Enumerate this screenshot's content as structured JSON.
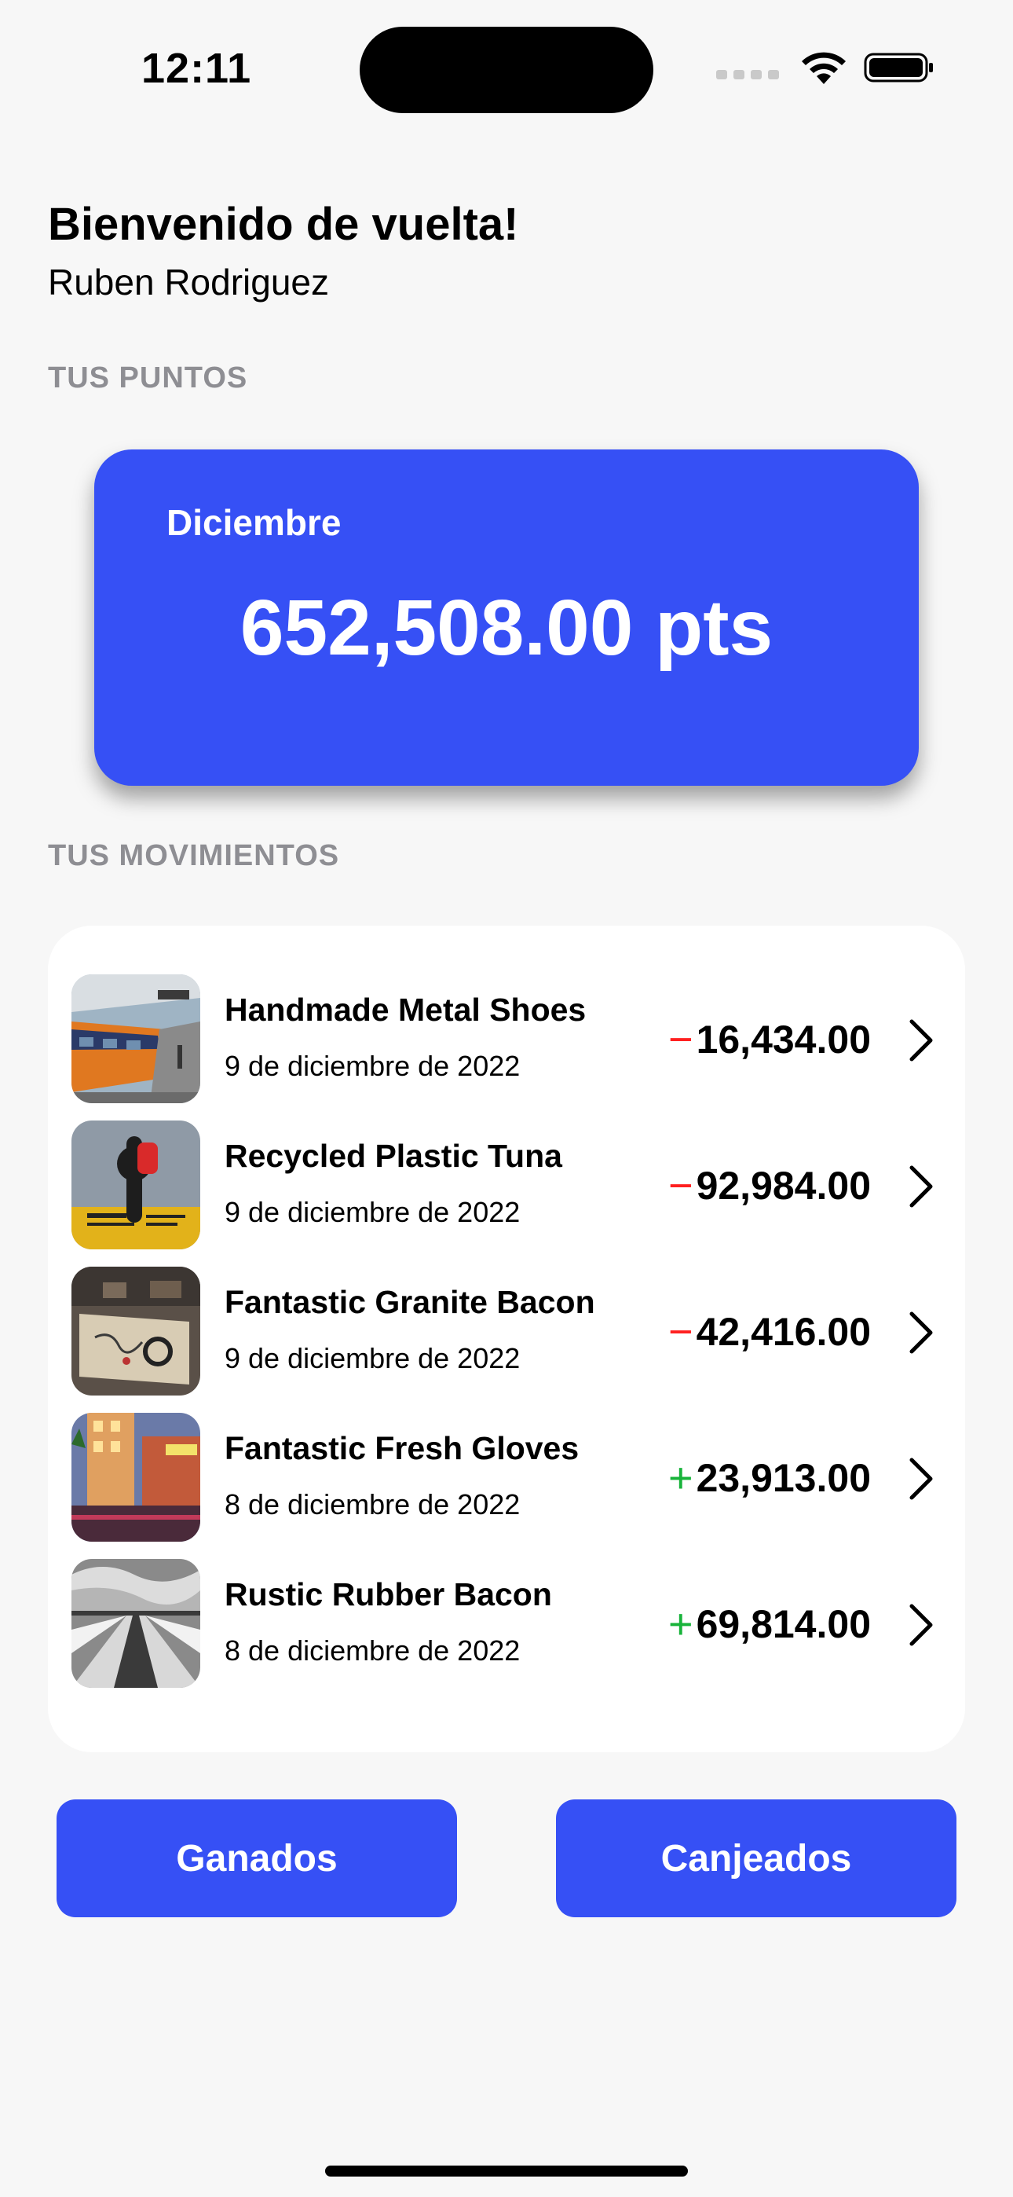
{
  "status_bar": {
    "time": "12:11"
  },
  "header": {
    "welcome": "Bienvenido de vuelta!",
    "user_name": "Ruben Rodriguez"
  },
  "points_section": {
    "label": "TUS PUNTOS",
    "month": "Diciembre",
    "value": "652,508.00 pts",
    "card_color": "#3650f5"
  },
  "movements_section": {
    "label": "TUS MOVIMIENTOS",
    "items": [
      {
        "title": "Handmade Metal Shoes",
        "date": "9 de diciembre de 2022",
        "sign": "−",
        "amount": "16,434.00",
        "type": "negative",
        "image": "train-station-photo"
      },
      {
        "title": "Recycled Plastic Tuna",
        "date": "9 de diciembre de 2022",
        "sign": "−",
        "amount": "92,984.00",
        "type": "negative",
        "image": "switch-handle-photo"
      },
      {
        "title": "Fantastic Granite Bacon",
        "date": "9 de diciembre de 2022",
        "sign": "−",
        "amount": "42,416.00",
        "type": "negative",
        "image": "workbench-photo"
      },
      {
        "title": "Fantastic Fresh Gloves",
        "date": "8 de diciembre de 2022",
        "sign": "+",
        "amount": "23,913.00",
        "type": "positive",
        "image": "hotel-street-photo"
      },
      {
        "title": "Rustic Rubber Bacon",
        "date": "8 de diciembre de 2022",
        "sign": "+",
        "amount": "69,814.00",
        "type": "positive",
        "image": "pier-bw-photo"
      }
    ]
  },
  "buttons": {
    "earned": "Ganados",
    "redeemed": "Canjeados"
  },
  "colors": {
    "accent": "#3650f5",
    "negative": "#ff2020",
    "positive": "#18b33a"
  }
}
